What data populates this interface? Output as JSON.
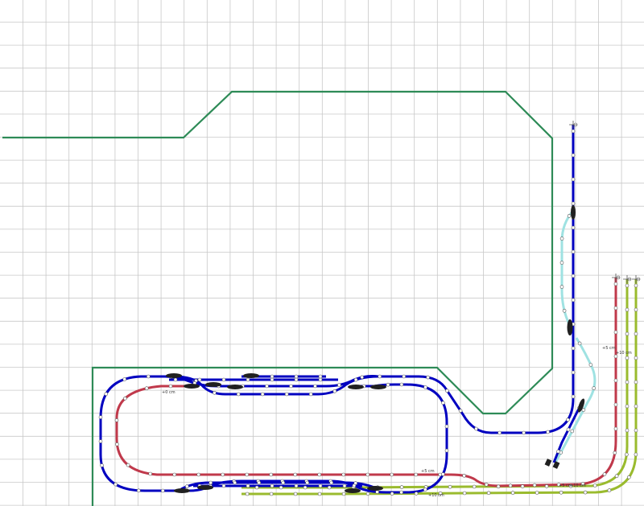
{
  "colors": {
    "background": "#ffffff",
    "grid": "#c8c8c8",
    "wall": "#2e8b57",
    "track_level0": "#0000c0",
    "track_siding": "#9fe2e2",
    "track_plus5": "#c0394b",
    "track_plus10": "#9abb2e",
    "ties": "#ffffff",
    "turnout": "#202020"
  },
  "grid": {
    "cell_label": "grid"
  },
  "levels": {
    "plus5_label": "+5 cm",
    "plus10_label": "+10 cm",
    "zero_label": "+0 cm"
  },
  "icons": [
    "turnout-icon",
    "track-end-icon",
    "buffer-stop-icon"
  ]
}
